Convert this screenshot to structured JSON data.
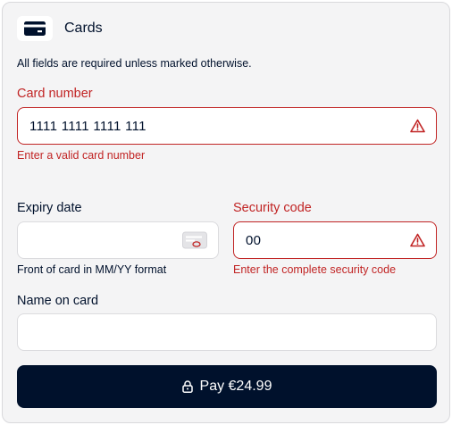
{
  "header": {
    "title": "Cards",
    "icon": "credit-card-icon"
  },
  "note": "All fields are required unless marked otherwise.",
  "card_number": {
    "label": "Card number",
    "value": "1111 1111 1111 111",
    "error": "Enter a valid card number",
    "icon": "warning-icon"
  },
  "expiry": {
    "label": "Expiry date",
    "value": "",
    "help": "Front of card in MM/YY format",
    "icon": "card-front-icon"
  },
  "security_code": {
    "label": "Security code",
    "value": "00",
    "error": "Enter the complete security code",
    "icon": "warning-icon"
  },
  "name_on_card": {
    "label": "Name on card",
    "value": ""
  },
  "pay_button": {
    "label": "Pay €24.99",
    "icon": "lock-icon"
  },
  "colors": {
    "primary": "#00112c",
    "error": "#c12424",
    "panel": "#f4f4f5"
  }
}
